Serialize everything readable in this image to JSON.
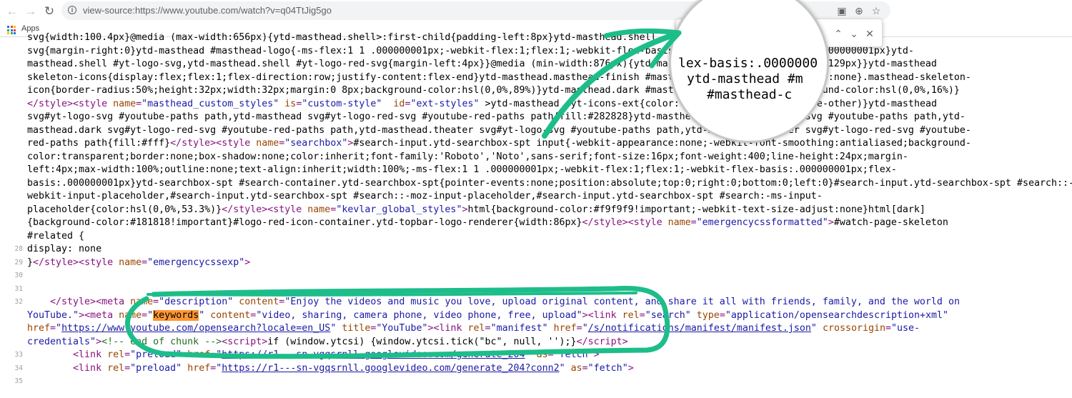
{
  "browser": {
    "url": "view-source:https://www.youtube.com/watch?v=q04TtJig5go",
    "bookmarks": {
      "apps_label": "Apps"
    }
  },
  "find_bar": {
    "query": "keywords"
  },
  "magnifier": {
    "lines": [
      "lex-basis:.0000000",
      "ytd-masthead #m",
      "#masthead-c"
    ]
  },
  "source": {
    "block_lines": [
      "svg{width:100.4px}@media (max-width:656px){ytd-masthead.shell>:first-child{padding-left:8px}ytd-masthead.shell",
      "svg{margin-right:0}ytd-masthead #masthead-logo{-ms-flex:1 1 .000000001px;-webkit-flex:1;flex:1;-webkit-flex-basis:.000000001px;flex-basis:.000000001px}ytd-",
      "masthead.shell #yt-logo-svg,ytd-masthead.shell #yt-logo-red-svg{margin-left:4px}}@media (min-width:876px){ytd-masthead #masthead-logo{width:129px}}ytd-masthead",
      "skeleton-icons{display:flex;flex:1;flex-direction:row;justify-content:flex-end}ytd-masthead.masthead-finish #masthead-skeleton-icons{display:none}.masthead-skeleton-",
      "icon{border-radius:50%;height:32px;width:32px;margin:0 8px;background-color:hsl(0,0%,89%)}ytd-masthead.dark #masthead-skeleton-icon{background-color:hsl(0,0%,16%)}"
    ],
    "style_masthead_custom": {
      "name_attr": "name",
      "name_val": "\"masthead_custom_styles\"",
      "is_attr": "is",
      "is_val": "\"custom-style\"",
      "id_attr": "id",
      "id_val": "\"ext-styles\"",
      "css_rest": " >ytd-masthead .yt-icons-ext{color:var(--yt-spec-icon-active-other)}ytd-masthead",
      "css_l2": "svg#yt-logo-svg #youtube-paths path,ytd-masthead svg#yt-logo-red-svg #youtube-red-paths path{fill:#282828}ytd-masthead.dark svg#yt-logo-svg #youtube-paths path,ytd-",
      "css_l3": "masthead.dark svg#yt-logo-red-svg #youtube-red-paths path,ytd-masthead.theater svg#yt-logo-svg #youtube-paths path,ytd-masthead.theater svg#yt-logo-red-svg #youtube-",
      "css_l4a": "red-paths path{fill:#fff}"
    },
    "style_searchbox": {
      "name_val": "\"searchbox\"",
      "css_l4": "#search-input.ytd-searchbox-spt input{-webkit-appearance:none;-webkit-font-smoothing:antialiased;background-",
      "css_l5": "color:transparent;border:none;box-shadow:none;color:inherit;font-family:'Roboto','Noto',sans-serif;font-size:16px;font-weight:400;line-height:24px;margin-",
      "css_l6": "left:4px;max-width:100%;outline:none;text-align:inherit;width:100%;-ms-flex:1 1 .000000001px;-webkit-flex:1;flex:1;-webkit-flex-basis:.000000001px;flex-",
      "css_l7": "basis:.000000001px}ytd-searchbox-spt #search-container.ytd-searchbox-spt{pointer-events:none;position:absolute;top:0;right:0;bottom:0;left:0}#search-input.ytd-searchbox-spt #search::-",
      "css_l8": "webkit-input-placeholder,#search-input.ytd-searchbox-spt #search::-moz-input-placeholder,#search-input.ytd-searchbox-spt #search:-ms-input-",
      "css_l9": "placeholder{color:hsl(0,0%,53.3%)}"
    },
    "style_kevlar": {
      "name_val": "\"kevlar_global_styles\"",
      "css_a": "html{background-color:#f9f9f9!important;-webkit-text-size-adjust:none}html[dark]",
      "css_b": "{background-color:#181818!important}#logo-red-icon-container.ytd-topbar-logo-renderer{width:86px}"
    },
    "style_emergency": {
      "name_val": "\"emergencycssformatted\"",
      "css_a": "#watch-page-skeleton",
      "css_b": "#related {"
    },
    "line_numbers": {
      "n28": "28",
      "n29": "29",
      "n30": "30",
      "n31": "31",
      "n32": "32",
      "n33": "33",
      "n34": "34",
      "n35": "35"
    },
    "line28": "display: none",
    "line29": {
      "close": "}",
      "name_val": "\"emergencycssexp\""
    },
    "line32": {
      "desc_name_val": "\"description\"",
      "desc_content_val": "\"Enjoy the videos and music you love, upload original content, and share it all with friends, family, and the world on",
      "desc_content_val2": "YouTube.\"",
      "kw_name": "keywords",
      "kw_content_val": "\"video, sharing, camera phone, video phone, free, upload\"",
      "link_rel_val": "\"search\"",
      "link_type_val": "\"application/opensearchdescription+xml\"",
      "href1": "https://www.youtube.com/opensearch?locale=en_US",
      "title_val": "\"YouTube\"",
      "manifest_rel_val": "\"manifest\"",
      "href2": "/s/notifications/manifest/manifest.json",
      "crossorigin_val": "\"use-",
      "crossorigin_val2": "credentials\"",
      "comment": "<!-- end of chunk -->",
      "script_text": "if (window.ytcsi) {window.ytcsi.tick(\"bc\", null, '');}"
    },
    "line33": {
      "href": "https://r1---sn-vgqsrnll.googlevideo.com/generate_204",
      "as_val": "\"fetch\""
    },
    "line34": {
      "href": "https://r1---sn-vgqsrnll.googlevideo.com/generate_204?conn2",
      "as_val": "\"fetch\""
    }
  }
}
